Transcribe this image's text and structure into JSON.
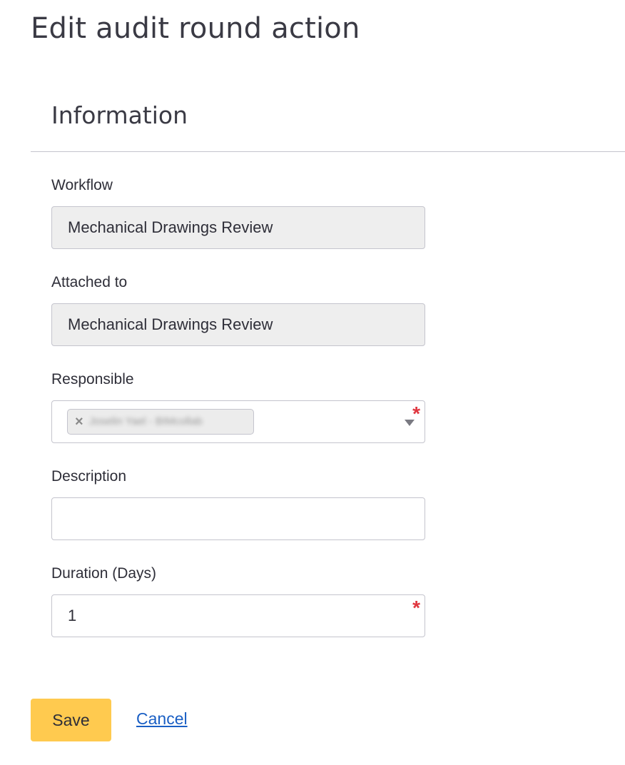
{
  "page": {
    "title": "Edit audit round action"
  },
  "section": {
    "title": "Information"
  },
  "fields": {
    "workflow": {
      "label": "Workflow",
      "value": "Mechanical Drawings Review"
    },
    "attached_to": {
      "label": "Attached to",
      "value": "Mechanical Drawings Review"
    },
    "responsible": {
      "label": "Responsible",
      "chip_remove_symbol": "×",
      "chip_text": "Joselin Yael - BIMcollab",
      "required_mark": "*"
    },
    "description": {
      "label": "Description",
      "value": ""
    },
    "duration": {
      "label": "Duration (Days)",
      "value": "1",
      "required_mark": "*"
    }
  },
  "actions": {
    "save_label": "Save",
    "cancel_label": "Cancel"
  },
  "colors": {
    "primary_button": "#ffca4f",
    "link": "#1a5fc4",
    "required": "#e0363f",
    "readonly_bg": "#eeeeee"
  },
  "icons": {
    "select_caret": "chevron-down-icon",
    "chip_remove": "close-icon"
  }
}
